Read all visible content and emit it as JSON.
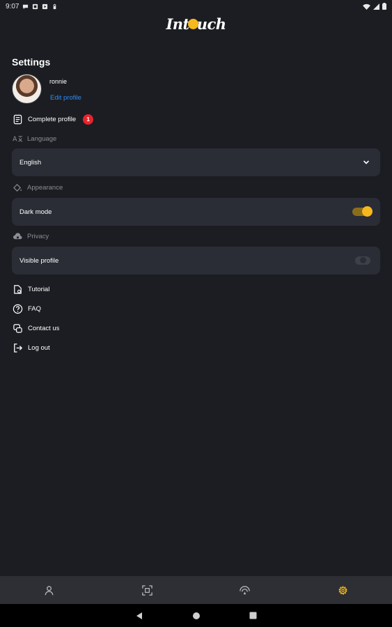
{
  "status_bar": {
    "time": "9:07"
  },
  "app": {
    "logo_text_left": "Int",
    "logo_text_right": "uch"
  },
  "settings": {
    "title": "Settings",
    "user": {
      "name": "ronnie",
      "edit_label": "Edit profile"
    },
    "complete_profile": {
      "label": "Complete profile",
      "badge_count": "1"
    },
    "language": {
      "section_label": "Language",
      "selected": "English"
    },
    "appearance": {
      "section_label": "Appearance",
      "dark_mode_label": "Dark mode",
      "dark_mode_on": true
    },
    "privacy": {
      "section_label": "Privacy",
      "visible_profile_label": "Visible profile",
      "visible_profile_on": false
    },
    "links": [
      {
        "label": "Tutorial",
        "icon": "tutorial-icon"
      },
      {
        "label": "FAQ",
        "icon": "help-circle-icon"
      },
      {
        "label": "Contact us",
        "icon": "contact-icon"
      },
      {
        "label": "Log out",
        "icon": "logout-icon"
      }
    ]
  },
  "bottom_nav": {
    "items": [
      {
        "icon": "profile-icon",
        "active": false
      },
      {
        "icon": "scan-icon",
        "active": false
      },
      {
        "icon": "nearby-icon",
        "active": false
      },
      {
        "icon": "settings-gear-icon",
        "active": true
      }
    ]
  },
  "colors": {
    "background": "#1b1d22",
    "card": "#2a2d35",
    "accent": "#f6b81c",
    "link": "#2f8cf6",
    "badge": "#e8232b"
  }
}
